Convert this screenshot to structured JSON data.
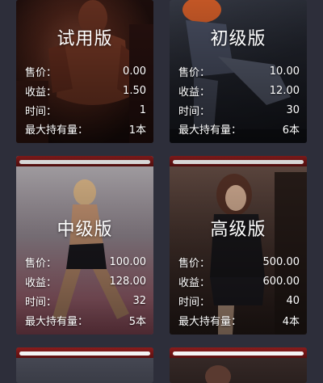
{
  "cards": [
    {
      "title": "试用版",
      "rows": [
        {
          "label": "售价：",
          "value": "0.00"
        },
        {
          "label": "收益：",
          "value": "1.50"
        },
        {
          "label": "时间：",
          "value": "1"
        },
        {
          "label": "最大持有量：",
          "value": "1本"
        }
      ]
    },
    {
      "title": "初级版",
      "rows": [
        {
          "label": "售价：",
          "value": "10.00"
        },
        {
          "label": "收益：",
          "value": "12.00"
        },
        {
          "label": "时间：",
          "value": "30"
        },
        {
          "label": "最大持有量：",
          "value": "6本"
        }
      ]
    },
    {
      "title": "中级版",
      "rows": [
        {
          "label": "售价：",
          "value": "100.00"
        },
        {
          "label": "收益：",
          "value": "128.00"
        },
        {
          "label": "时间：",
          "value": "32"
        },
        {
          "label": "最大持有量：",
          "value": "5本"
        }
      ]
    },
    {
      "title": "高级版",
      "rows": [
        {
          "label": "售价：",
          "value": "500.00"
        },
        {
          "label": "收益：",
          "value": "600.00"
        },
        {
          "label": "时间：",
          "value": "40"
        },
        {
          "label": "最大持有量：",
          "value": "4本"
        }
      ]
    }
  ]
}
